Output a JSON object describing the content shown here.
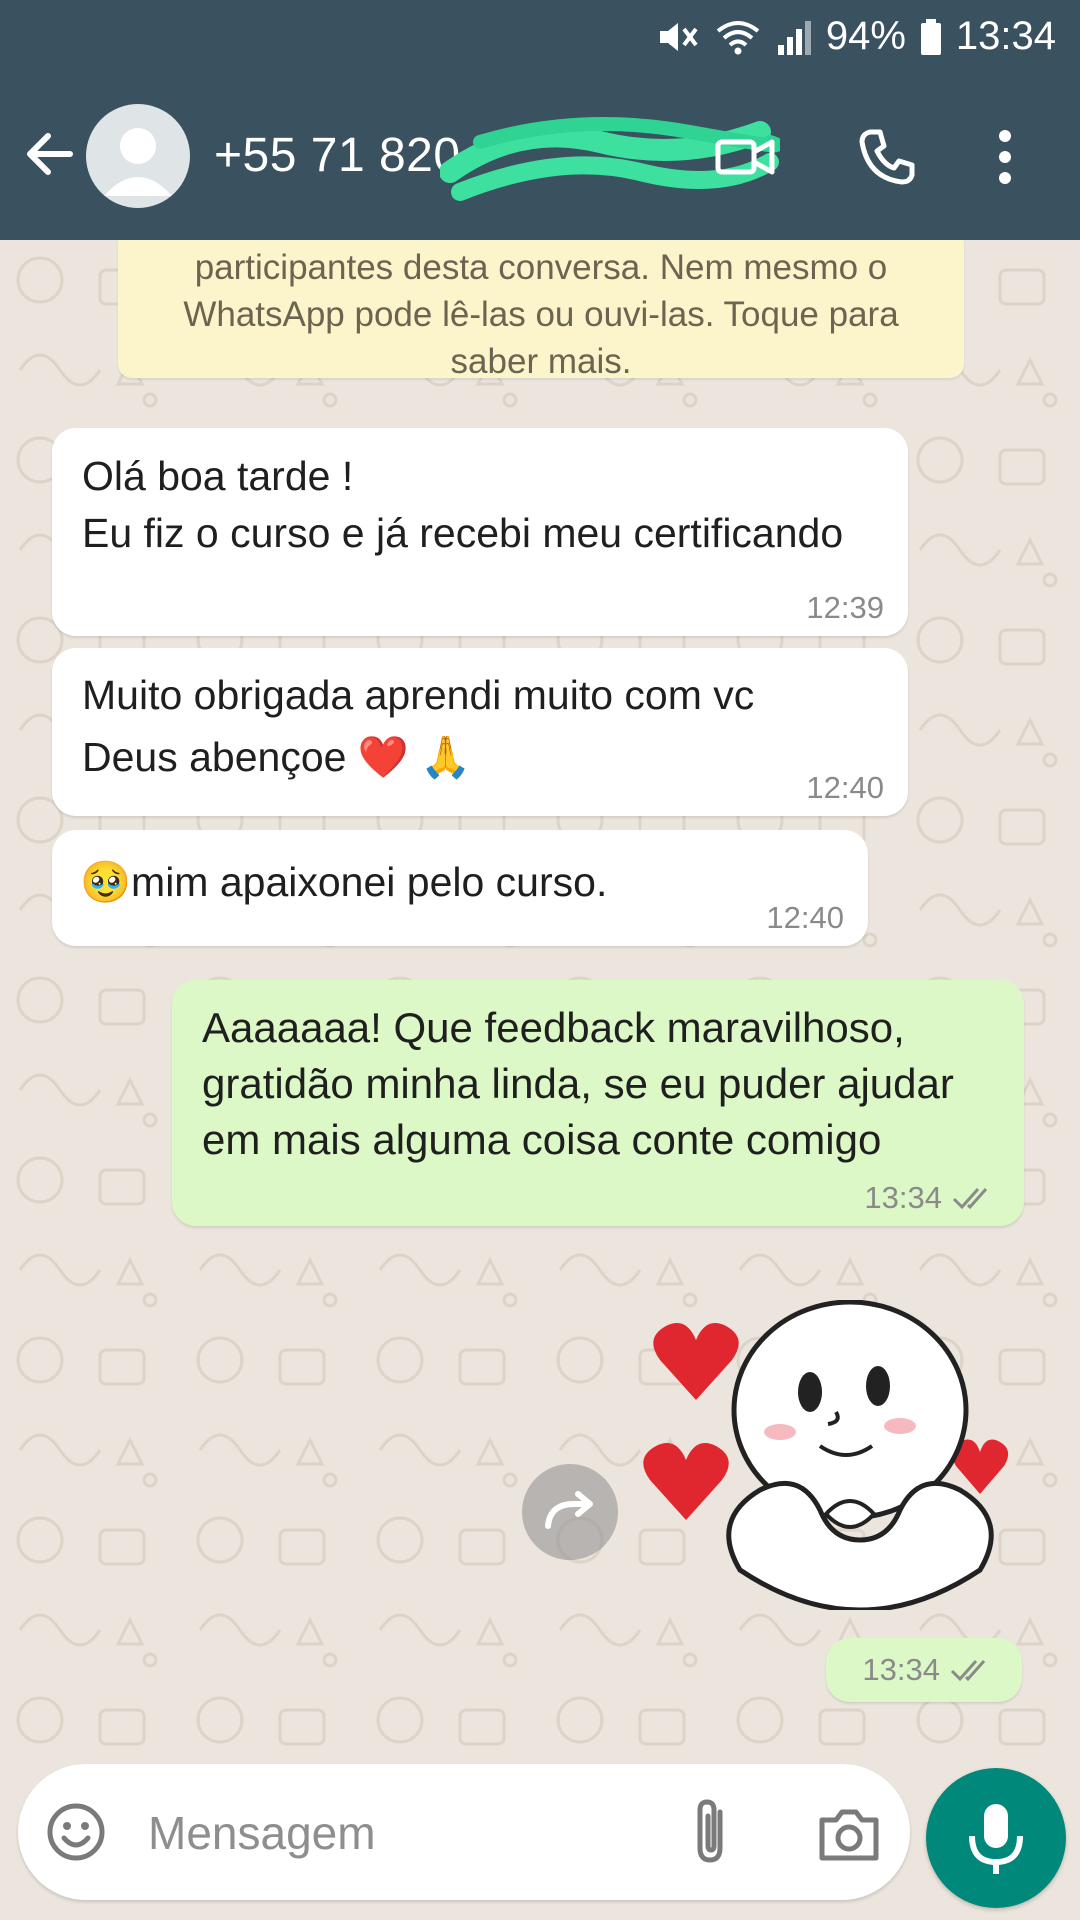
{
  "status_bar": {
    "battery": "94%",
    "time": "13:34"
  },
  "header": {
    "contact_name": "+55 71 820"
  },
  "chat": {
    "encryption_notice": "participantes desta conversa. Nem mesmo o WhatsApp pode lê-las ou ouvi-las. Toque para saber mais.",
    "messages": [
      {
        "direction": "in",
        "text": "Olá boa tarde !\nEu fiz o curso e já recebi meu certificando",
        "time": "12:39"
      },
      {
        "direction": "in",
        "text": "Muito obrigada aprendi muito com vc\nDeus abençoe ❤️ 🙏",
        "time": "12:40"
      },
      {
        "direction": "in",
        "text": "🥹mim apaixonei pelo curso.",
        "time": "12:40"
      },
      {
        "direction": "out",
        "text": "Aaaaaaa! Que feedback maravilhoso, gratidão minha linda, se eu puder ajudar em mais alguma coisa conte comigo",
        "time": "13:34",
        "status": "read"
      },
      {
        "direction": "out",
        "type": "sticker",
        "time": "13:34",
        "status": "read"
      }
    ]
  },
  "composer": {
    "placeholder": "Mensagem"
  },
  "colors": {
    "header": "#3a5260",
    "outgoing_bubble": "#dcf8c6",
    "incoming_bubble": "#ffffff",
    "notice": "#fcf4cb",
    "mic_button": "#00897b"
  }
}
